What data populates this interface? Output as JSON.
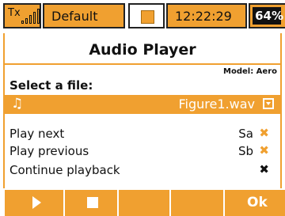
{
  "status": {
    "tx_label": "Tx",
    "model_name": "Default",
    "time": "12:22:29",
    "battery": "64%"
  },
  "screen": {
    "title": "Audio Player",
    "model_line": "Model: Aero",
    "select_label": "Select a file:",
    "file_icon": "music-note-icon",
    "file_name": "Figure1.wav"
  },
  "options": [
    {
      "label": "Play next",
      "value": "Sa",
      "state": "orange-x"
    },
    {
      "label": "Play previous",
      "value": "Sb",
      "state": "orange-x"
    },
    {
      "label": "Continue playback",
      "value": "",
      "state": "black-x"
    }
  ],
  "buttons": {
    "f1_icon": "play-icon",
    "f2_icon": "stop-icon",
    "f5_label": "Ok"
  },
  "colors": {
    "accent": "#f0a030",
    "text": "#111111",
    "background": "#ffffff"
  }
}
